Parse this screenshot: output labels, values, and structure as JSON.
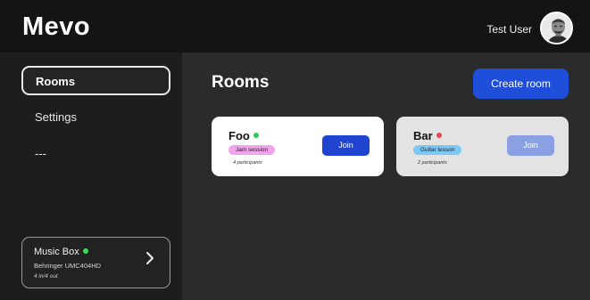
{
  "app": {
    "title": "Mevo"
  },
  "user": {
    "name": "Test User",
    "avatar_icon": "user-portrait-icon"
  },
  "sidebar": {
    "items": [
      {
        "label": "Rooms",
        "active": true
      },
      {
        "label": "Settings",
        "active": false
      },
      {
        "label": "---",
        "active": false
      }
    ],
    "device": {
      "name": "Music Box",
      "status_color": "#34e05a",
      "model": "Behringer UMC404HD",
      "io": "4 in/4 out",
      "action_icon": "chevron-right-icon"
    }
  },
  "main": {
    "title": "Rooms",
    "create_label": "Create room",
    "rooms": [
      {
        "name": "Foo",
        "status_color": "#2ec95c",
        "tag": "Jam session",
        "tag_color": "#f2a4ec",
        "participants": "4 participants",
        "join_label": "Join",
        "join_color": "#1f44d0",
        "card_color": "#ffffff"
      },
      {
        "name": "Bar",
        "status_color": "#e5484d",
        "tag": "Guitar lesson",
        "tag_color": "#7cc8f5",
        "participants": "2 participants",
        "join_label": "Join",
        "join_color": "#8b9fe3",
        "card_color": "#e3e3e3"
      }
    ]
  },
  "colors": {
    "accent": "#1f4ed8",
    "topbar": "#141414",
    "sidebar": "#1d1d1d",
    "content": "#2b2b2b"
  }
}
